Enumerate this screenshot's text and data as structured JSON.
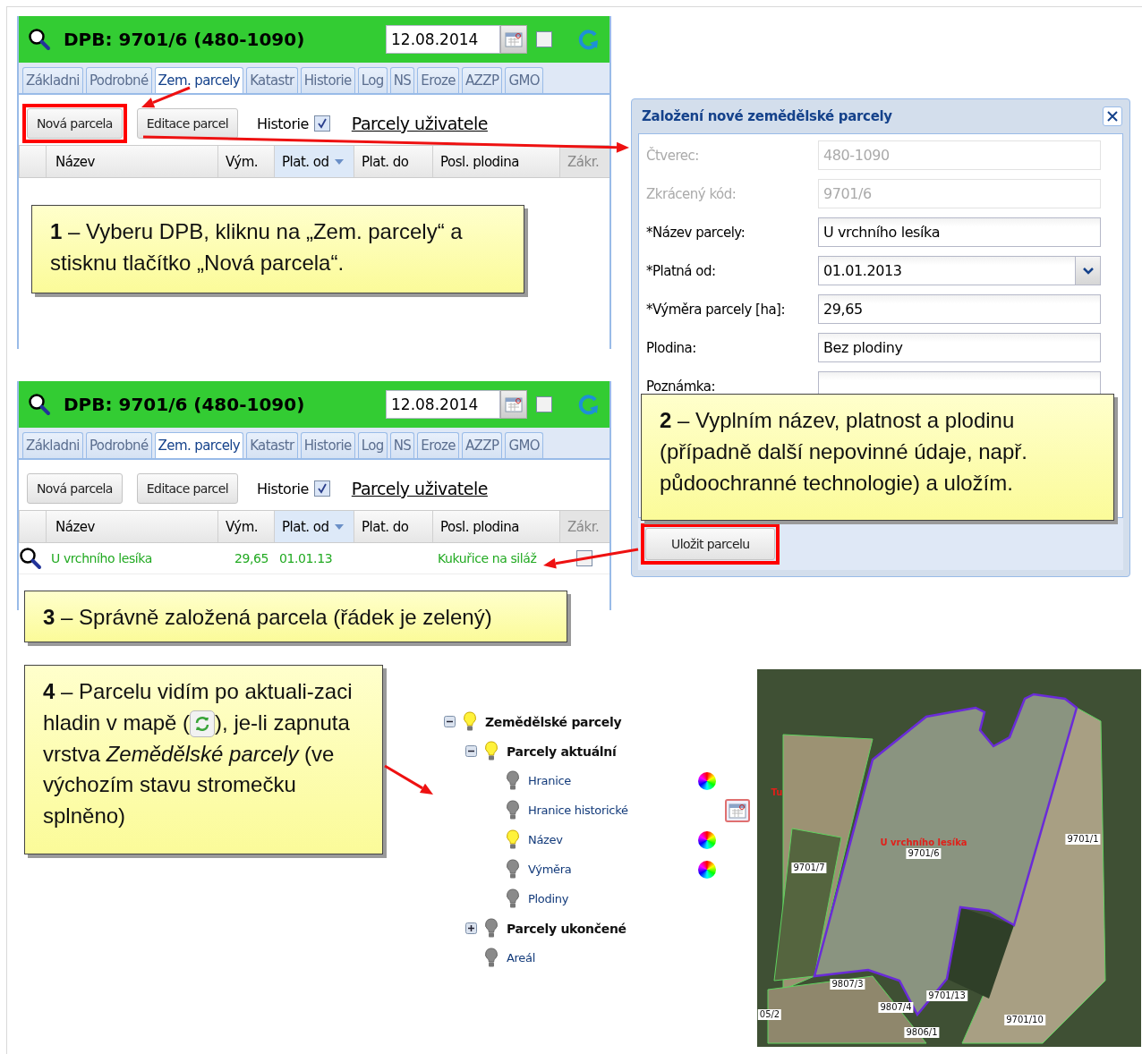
{
  "panels": [
    {
      "title": "DPB: 9701/6 (480-1090)",
      "date": "12.08.2014",
      "date_checked": false,
      "tabs": [
        {
          "label": "Základni",
          "selected": false
        },
        {
          "label": "Podrobné",
          "selected": false
        },
        {
          "label": "Zem. parcely",
          "selected": true
        },
        {
          "label": "Katastr",
          "selected": false
        },
        {
          "label": "Historie",
          "selected": false
        },
        {
          "label": "Log",
          "selected": false
        },
        {
          "label": "NS",
          "selected": false
        },
        {
          "label": "Eroze",
          "selected": false
        },
        {
          "label": "AZZP",
          "selected": false
        },
        {
          "label": "GMO",
          "selected": false
        }
      ],
      "buttons": [
        {
          "label": "Nová parcela",
          "highlighted": true
        },
        {
          "label": "Editace parcel",
          "highlighted": false
        }
      ],
      "history": {
        "label": "Historie",
        "checked": true
      },
      "link": "Parcely uživatele",
      "columns": [
        {
          "label": "Název",
          "sorted": false,
          "disabled": false
        },
        {
          "label": "Vým.",
          "sorted": false,
          "disabled": false
        },
        {
          "label": "Plat. od",
          "sorted": true,
          "disabled": false
        },
        {
          "label": "Plat. do",
          "sorted": false,
          "disabled": false
        },
        {
          "label": "Posl. plodina",
          "sorted": false,
          "disabled": false
        },
        {
          "label": "Zákr.",
          "sorted": false,
          "disabled": true
        }
      ]
    },
    {
      "title": "DPB: 9701/6 (480-1090)",
      "date": "12.08.2014",
      "date_checked": false,
      "tabs": [
        {
          "label": "Základni",
          "selected": false
        },
        {
          "label": "Podrobné",
          "selected": false
        },
        {
          "label": "Zem. parcely",
          "selected": true
        },
        {
          "label": "Katastr",
          "selected": false
        },
        {
          "label": "Historie",
          "selected": false
        },
        {
          "label": "Log",
          "selected": false
        },
        {
          "label": "NS",
          "selected": false
        },
        {
          "label": "Eroze",
          "selected": false
        },
        {
          "label": "AZZP",
          "selected": false
        },
        {
          "label": "GMO",
          "selected": false
        }
      ],
      "buttons": [
        {
          "label": "Nová parcela",
          "highlighted": false
        },
        {
          "label": "Editace parcel",
          "highlighted": false
        }
      ],
      "history": {
        "label": "Historie",
        "checked": true
      },
      "link": "Parcely uživatele",
      "columns": [
        {
          "label": "Název",
          "sorted": false,
          "disabled": false
        },
        {
          "label": "Vým.",
          "sorted": false,
          "disabled": false
        },
        {
          "label": "Plat. od",
          "sorted": true,
          "disabled": false
        },
        {
          "label": "Plat. do",
          "sorted": false,
          "disabled": false
        },
        {
          "label": "Posl. plodina",
          "sorted": false,
          "disabled": false
        },
        {
          "label": "Zákr.",
          "sorted": false,
          "disabled": true
        }
      ],
      "rows": [
        {
          "name": "U vrchního lesíka",
          "area": "29,65",
          "valid_from": "01.01.13",
          "crop": "Kukuřice na siláž",
          "valid": true,
          "closed": false
        }
      ]
    }
  ],
  "dialog": {
    "title": "Založení nové zemědělské parcely",
    "fields": [
      {
        "label": "Čtverec:",
        "value": "480-1090",
        "kind": "text",
        "disabled": true
      },
      {
        "label": "Zkrácený kód:",
        "value": "9701/6",
        "kind": "text",
        "disabled": true
      },
      {
        "label": "*Název parcely:",
        "value": "U vrchního lesíka",
        "kind": "text",
        "disabled": false
      },
      {
        "label": "*Platná od:",
        "value": "01.01.2013",
        "kind": "select",
        "disabled": false
      },
      {
        "label": "*Výměra parcely [ha]:",
        "value": "29,65",
        "kind": "text",
        "disabled": false
      },
      {
        "label": "Plodina:",
        "value": "Bez plodiny",
        "kind": "text",
        "disabled": false
      },
      {
        "label": "Poznámka:",
        "kind": "text",
        "disabled": false
      }
    ],
    "save_button": {
      "label": "Uložit parcelu",
      "highlighted": true
    }
  },
  "callouts": [
    {
      "kind": "plain",
      "text": "**1** – Vyberu DPB, kliknu na „Zem. parcely“ a stisknu tlačítko „Nová parcela“."
    },
    {
      "kind": "plain",
      "text": "**2** – Vyplním název, platnost a plodinu (případně další nepovinné údaje, např. půdoochranné technologie) a uložím."
    },
    {
      "kind": "plain",
      "text": "**3** – Správně založená parcela (řádek je zelený)"
    },
    {
      "kind": "icon",
      "text_before": "**4** – Parcelu vidím po aktuali-zaci hladin v mapě (",
      "text_after": "), je-li zapnuta vrstva *Zemědělské parcely* (ve výchozím stavu stromečku splněno)"
    }
  ],
  "layer_tree": [
    {
      "label": "Zemědělské parcely",
      "on": true,
      "expanded": true,
      "children": [
        {
          "label": "Parcely aktuální",
          "on": true,
          "expanded": true,
          "children": [
            {
              "label": "Hranice",
              "on": false,
              "kind": "color"
            },
            {
              "label": "Hranice historické",
              "on": false,
              "kind": "date"
            },
            {
              "label": "Název",
              "on": true,
              "kind": "color"
            },
            {
              "label": "Výměra",
              "on": false,
              "kind": "color"
            },
            {
              "label": "Plodiny",
              "on": false
            }
          ]
        },
        {
          "label": "Parcely ukončené",
          "on": false,
          "expanded": false
        },
        {
          "label": "Areál",
          "on": false
        }
      ]
    }
  ],
  "map": {
    "labels": [
      {
        "text": "U vrchního lesíka",
        "kind": "name"
      },
      {
        "text": "9701/6",
        "kind": "parcel"
      },
      {
        "text": "9701/7",
        "kind": "parcel"
      },
      {
        "text": "9701/1",
        "kind": "parcel"
      },
      {
        "text": "9807/3",
        "kind": "parcel"
      },
      {
        "text": "9807/4",
        "kind": "parcel"
      },
      {
        "text": "9701/13",
        "kind": "parcel"
      },
      {
        "text": "9701/10",
        "kind": "parcel"
      },
      {
        "text": "9806/1",
        "kind": "parcel"
      },
      {
        "text": "05/2",
        "kind": "parcel"
      },
      {
        "text": "Tu",
        "kind": "name"
      }
    ]
  }
}
